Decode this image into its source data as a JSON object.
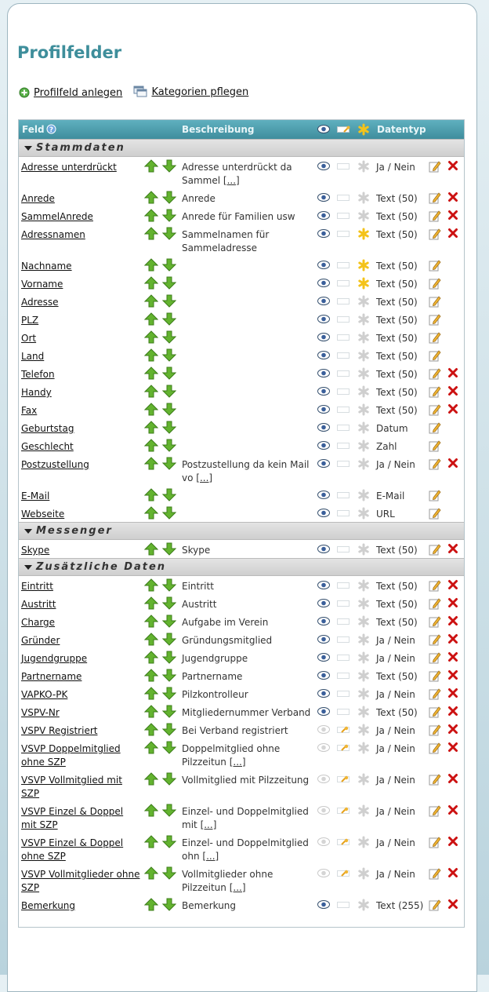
{
  "page": {
    "title": "Profilfelder",
    "actions": [
      {
        "label": "Profilfeld anlegen",
        "icon": "add-circle-icon"
      },
      {
        "label": "Kategorien pflegen",
        "icon": "windows-icon"
      }
    ]
  },
  "table": {
    "headers": {
      "field": "Feld",
      "description": "Beschreibung",
      "datatype": "Datentyp"
    },
    "colors": {
      "header": "#4a9aaa",
      "title": "#3e8e9b",
      "delete": "#cc1111",
      "up_arrow": "#5aa62a"
    },
    "categories": [
      {
        "name": "Stammdaten",
        "rows": [
          {
            "name": "Adresse unterdrückt",
            "desc": "Adresse unterdrückt da Sammel",
            "more": "[...]",
            "visible": true,
            "editable": false,
            "required": false,
            "type": "Ja / Nein",
            "deletable": true,
            "tall": true
          },
          {
            "name": "Anrede",
            "desc": "Anrede",
            "more": "",
            "visible": true,
            "editable": false,
            "required": false,
            "type": "Text (50)",
            "deletable": true,
            "tall": false
          },
          {
            "name": "SammelAnrede",
            "desc": "Anrede für Familien usw",
            "more": "",
            "visible": true,
            "editable": false,
            "required": false,
            "type": "Text (50)",
            "deletable": true,
            "tall": false
          },
          {
            "name": "Adressnamen",
            "desc": "Sammelnamen für Sammeladresse",
            "more": "",
            "visible": true,
            "editable": false,
            "required": true,
            "type": "Text (50)",
            "deletable": true,
            "tall": true
          },
          {
            "name": "Nachname",
            "desc": "",
            "more": "",
            "visible": true,
            "editable": false,
            "required": true,
            "type": "Text (50)",
            "deletable": false,
            "tall": false
          },
          {
            "name": "Vorname",
            "desc": "",
            "more": "",
            "visible": true,
            "editable": false,
            "required": true,
            "type": "Text (50)",
            "deletable": false,
            "tall": false
          },
          {
            "name": "Adresse",
            "desc": "",
            "more": "",
            "visible": true,
            "editable": false,
            "required": false,
            "type": "Text (50)",
            "deletable": false,
            "tall": false
          },
          {
            "name": "PLZ",
            "desc": "",
            "more": "",
            "visible": true,
            "editable": false,
            "required": false,
            "type": "Text (50)",
            "deletable": false,
            "tall": false
          },
          {
            "name": "Ort",
            "desc": "",
            "more": "",
            "visible": true,
            "editable": false,
            "required": false,
            "type": "Text (50)",
            "deletable": false,
            "tall": false
          },
          {
            "name": "Land",
            "desc": "",
            "more": "",
            "visible": true,
            "editable": false,
            "required": false,
            "type": "Text (50)",
            "deletable": false,
            "tall": false
          },
          {
            "name": "Telefon",
            "desc": "",
            "more": "",
            "visible": true,
            "editable": false,
            "required": false,
            "type": "Text (50)",
            "deletable": true,
            "tall": false
          },
          {
            "name": "Handy",
            "desc": "",
            "more": "",
            "visible": true,
            "editable": false,
            "required": false,
            "type": "Text (50)",
            "deletable": true,
            "tall": false
          },
          {
            "name": "Fax",
            "desc": "",
            "more": "",
            "visible": true,
            "editable": false,
            "required": false,
            "type": "Text (50)",
            "deletable": true,
            "tall": false
          },
          {
            "name": "Geburtstag",
            "desc": "",
            "more": "",
            "visible": true,
            "editable": false,
            "required": false,
            "type": "Datum",
            "deletable": false,
            "tall": false
          },
          {
            "name": "Geschlecht",
            "desc": "",
            "more": "",
            "visible": true,
            "editable": false,
            "required": false,
            "type": "Zahl",
            "deletable": false,
            "tall": false
          },
          {
            "name": "Postzustellung",
            "desc": "Postzustellung da kein Mail vo",
            "more": "[...]",
            "visible": true,
            "editable": false,
            "required": false,
            "type": "Ja / Nein",
            "deletable": true,
            "tall": true
          },
          {
            "name": "E-Mail",
            "desc": "",
            "more": "",
            "visible": true,
            "editable": false,
            "required": false,
            "type": "E-Mail",
            "deletable": false,
            "tall": false
          },
          {
            "name": "Webseite",
            "desc": "",
            "more": "",
            "visible": true,
            "editable": false,
            "required": false,
            "type": "URL",
            "deletable": false,
            "tall": false
          }
        ]
      },
      {
        "name": "Messenger",
        "rows": [
          {
            "name": "Skype",
            "desc": "Skype",
            "more": "",
            "visible": true,
            "editable": false,
            "required": false,
            "type": "Text (50)",
            "deletable": true,
            "tall": false
          }
        ]
      },
      {
        "name": "Zusätzliche Daten",
        "rows": [
          {
            "name": "Eintritt",
            "desc": "Eintritt",
            "more": "",
            "visible": true,
            "editable": false,
            "required": false,
            "type": "Text (50)",
            "deletable": true,
            "tall": false
          },
          {
            "name": "Austritt",
            "desc": "Austritt",
            "more": "",
            "visible": true,
            "editable": false,
            "required": false,
            "type": "Text (50)",
            "deletable": true,
            "tall": false
          },
          {
            "name": "Charge",
            "desc": "Aufgabe im Verein",
            "more": "",
            "visible": true,
            "editable": false,
            "required": false,
            "type": "Text (50)",
            "deletable": true,
            "tall": false
          },
          {
            "name": "Gründer",
            "desc": "Gründungsmitglied",
            "more": "",
            "visible": true,
            "editable": false,
            "required": false,
            "type": "Ja / Nein",
            "deletable": true,
            "tall": false
          },
          {
            "name": "Jugendgruppe",
            "desc": "Jugendgruppe",
            "more": "",
            "visible": true,
            "editable": false,
            "required": false,
            "type": "Ja / Nein",
            "deletable": true,
            "tall": false
          },
          {
            "name": "Partnername",
            "desc": "Partnername",
            "more": "",
            "visible": true,
            "editable": false,
            "required": false,
            "type": "Text (50)",
            "deletable": true,
            "tall": false
          },
          {
            "name": "VAPKO-PK",
            "desc": "Pilzkontrolleur",
            "more": "",
            "visible": true,
            "editable": false,
            "required": false,
            "type": "Ja / Nein",
            "deletable": true,
            "tall": false
          },
          {
            "name": "VSPV-Nr",
            "desc": "Mitgliedernummer Verband",
            "more": "",
            "visible": true,
            "editable": false,
            "required": false,
            "type": "Text (50)",
            "deletable": true,
            "tall": false
          },
          {
            "name": "VSPV Registriert",
            "desc": "Bei Verband registriert",
            "more": "",
            "visible": false,
            "editable": true,
            "required": false,
            "type": "Ja / Nein",
            "deletable": true,
            "tall": false
          },
          {
            "name": "VSVP Doppelmitglied ohne SZP",
            "desc": "Doppelmitglied ohne Pilzzeitun",
            "more": "[...]",
            "visible": false,
            "editable": true,
            "required": false,
            "type": "Ja / Nein",
            "deletable": true,
            "tall": true
          },
          {
            "name": "VSVP Vollmitglied mit SZP",
            "desc": "Vollmitglied mit Pilzzeitung",
            "more": "",
            "visible": false,
            "editable": true,
            "required": false,
            "type": "Ja / Nein",
            "deletable": true,
            "tall": true
          },
          {
            "name": "VSVP Einzel & Doppel mit SZP",
            "desc": "Einzel- und Doppelmitglied mit",
            "more": "[...]",
            "visible": false,
            "editable": true,
            "required": false,
            "type": "Ja / Nein",
            "deletable": true,
            "tall": true
          },
          {
            "name": "VSVP Einzel & Doppel ohne SZP",
            "desc": "Einzel- und Doppelmitglied ohn",
            "more": "[...]",
            "visible": false,
            "editable": true,
            "required": false,
            "type": "Ja / Nein",
            "deletable": true,
            "tall": true
          },
          {
            "name": "VSVP Vollmitglieder ohne SZP",
            "desc": "Vollmitglieder ohne Pilzzeitun",
            "more": "[...]",
            "visible": false,
            "editable": true,
            "required": false,
            "type": "Ja / Nein",
            "deletable": true,
            "tall": true
          },
          {
            "name": "Bemerkung",
            "desc": "Bemerkung",
            "more": "",
            "visible": true,
            "editable": false,
            "required": false,
            "type": "Text (255)",
            "deletable": true,
            "tall": true
          }
        ]
      }
    ]
  }
}
